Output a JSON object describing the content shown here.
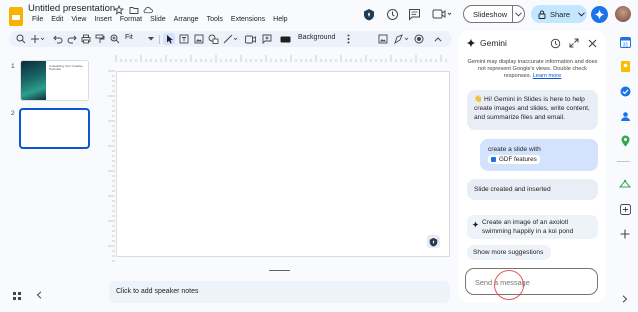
{
  "app": {
    "title": "Untitled presentation",
    "menus": [
      "File",
      "Edit",
      "View",
      "Insert",
      "Format",
      "Slide",
      "Arrange",
      "Tools",
      "Extensions",
      "Help"
    ]
  },
  "header": {
    "slideshow_label": "Slideshow",
    "share_label": "Share"
  },
  "toolbar": {
    "zoom_label": "Fit",
    "background_label": "Background"
  },
  "filmstrip": {
    "slides": [
      {
        "number": "1",
        "title": "Unleashing Your Creative Potential"
      },
      {
        "number": "2"
      }
    ]
  },
  "editor": {
    "speaker_notes_placeholder": "Click to add speaker notes"
  },
  "gemini": {
    "title": "Gemini",
    "disclaimer": "Gemini may display inaccurate information and does not represent Google's views. Double check responses.",
    "learn_more": "Learn more",
    "welcome": "👋 Hi! Gemini in Slides is here to help create images and slides, write content, and summarize files and email.",
    "user_prompt": "create a slide with",
    "user_chip": "GDF features",
    "response": "Slide created and inserted",
    "suggestion": "Create an image of an axolotl swimming happily in a koi pond",
    "show_more": "Show more suggestions",
    "input_placeholder": "Send a message"
  },
  "colors": {
    "accent": "#0b57d0",
    "share_bg": "#c2e7ff",
    "gemini_blue": "#1a73e8",
    "slides_yellow": "#f4b400"
  }
}
